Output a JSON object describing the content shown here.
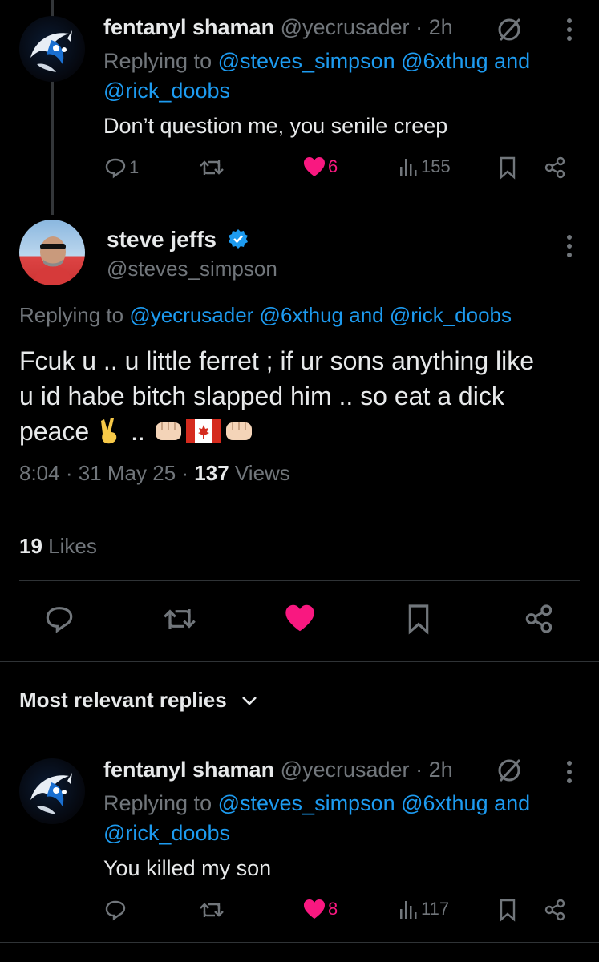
{
  "colors": {
    "accent": "#1d9bf0",
    "like": "#f91880",
    "muted": "#71767b",
    "text": "#e7e9ea",
    "divider": "#2f3336"
  },
  "tweet1": {
    "name": "fentanyl shaman",
    "handle": "@yecrusader",
    "time": "· 2h",
    "replying_prefix": "Replying to",
    "mentions_line1": "@steves_simpson @6xthug",
    "and": "and",
    "mentions_line2": "@rick_doobs",
    "text": "Don’t question me, you senile creep",
    "replies": "1",
    "likes": "6",
    "views": "155"
  },
  "main_tweet": {
    "name": "steve jeffs",
    "handle": "@steves_simpson",
    "replying_prefix": "Replying to",
    "mentions": "@yecrusader @6xthug",
    "and": "and",
    "mention_last": "@rick_doobs",
    "text_line1": "Fcuk u .. u little ferret ; if ur sons anything like",
    "text_line2": "u id habe bitch slapped him  .. so eat a dick",
    "text_line3_prefix": "peace",
    "text_line3_dots": "..",
    "time": "8:04",
    "date": "31 May 25",
    "views_count": "137",
    "views_label": "Views",
    "likes_count": "19",
    "likes_label": "Likes"
  },
  "replies_header": {
    "label": "Most relevant replies"
  },
  "tweet2": {
    "name": "fentanyl shaman",
    "handle": "@yecrusader",
    "time": "· 2h",
    "replying_prefix": "Replying to",
    "mentions_line1": "@steves_simpson @6xthug",
    "and": "and",
    "mentions_line2": "@rick_doobs",
    "text": "You killed my son",
    "likes": "8",
    "views": "117"
  }
}
